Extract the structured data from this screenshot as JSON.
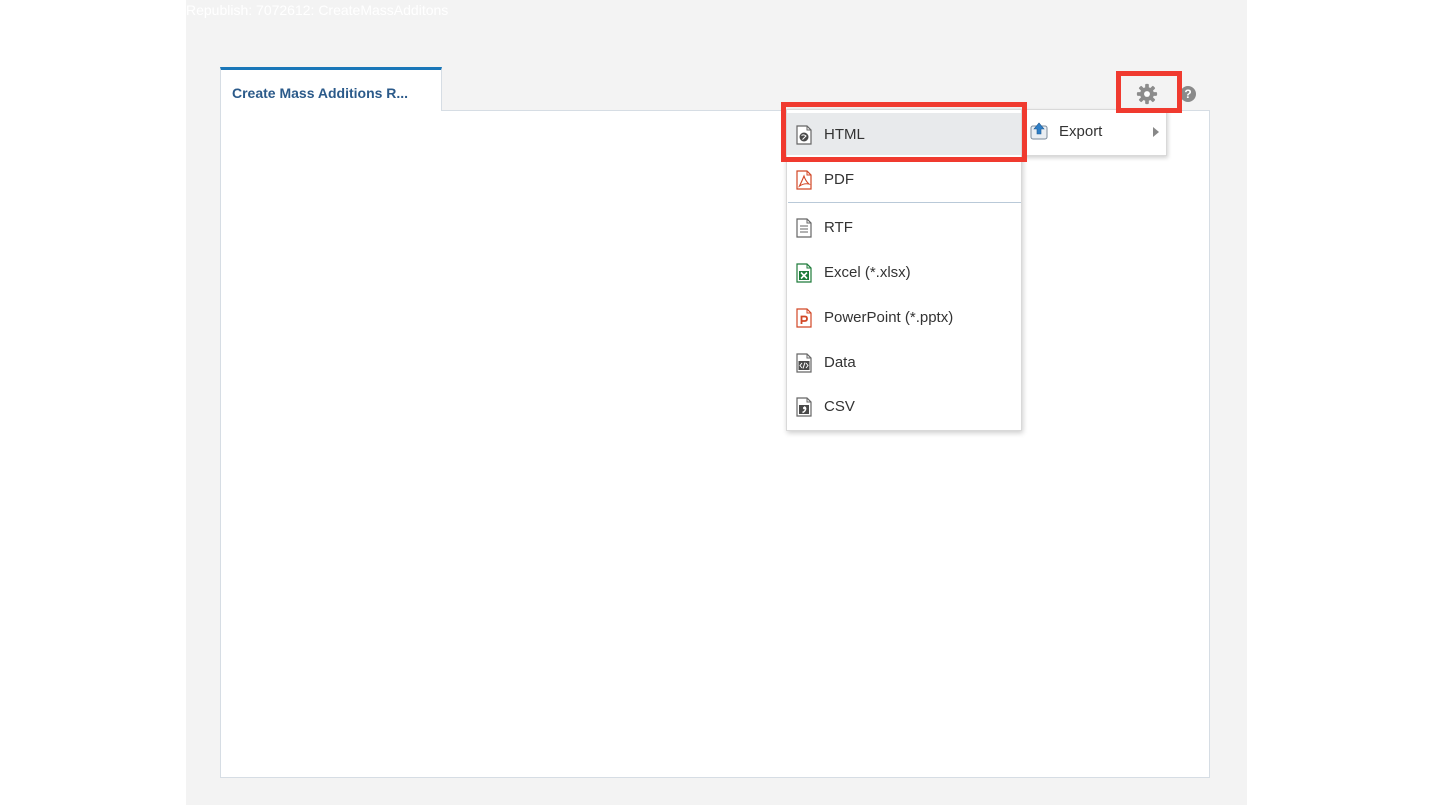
{
  "page": {
    "title": "Republish: 7072612: CreateMassAdditons"
  },
  "tabs": [
    {
      "label": "Create Mass Additions R...",
      "active": true
    }
  ],
  "toolbar": {
    "settings_icon": "gear-icon",
    "help_icon": "help-icon",
    "help_glyph": "?"
  },
  "export_menu": {
    "label": "Export",
    "icon": "export-upload-icon"
  },
  "format_menu": {
    "items": [
      {
        "label": "HTML",
        "icon": "html-globe-icon",
        "selected": true
      },
      {
        "label": "PDF",
        "icon": "pdf-icon"
      },
      {
        "label": "RTF",
        "icon": "rtf-document-icon"
      },
      {
        "label": "Excel (*.xlsx)",
        "icon": "excel-icon"
      },
      {
        "label": "PowerPoint (*.pptx)",
        "icon": "powerpoint-icon"
      },
      {
        "label": "Data",
        "icon": "data-xml-icon"
      },
      {
        "label": "CSV",
        "icon": "csv-icon"
      }
    ]
  },
  "colors": {
    "highlight": "#f03a2f",
    "tab_accent": "#1976b8",
    "tab_text": "#2b5a8a",
    "excel": "#1e7b3a",
    "pdf_ppt": "#d24726"
  }
}
